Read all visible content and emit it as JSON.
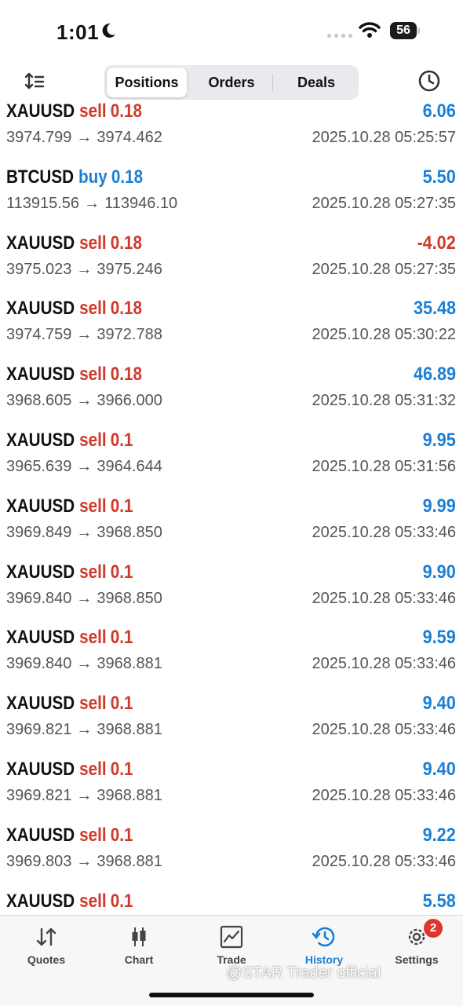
{
  "status_bar": {
    "time": "1:01",
    "battery": "56"
  },
  "toolbar": {
    "tabs": [
      {
        "label": "Positions",
        "active": true
      },
      {
        "label": "Orders",
        "active": false
      },
      {
        "label": "Deals",
        "active": false
      }
    ]
  },
  "deals": [
    {
      "symbol": "XAUUSD",
      "side": "sell",
      "volume": "0.18",
      "profit": "6.06",
      "open_price": "3974.799",
      "close_price": "3974.462",
      "time": "2025.10.28 05:25:57"
    },
    {
      "symbol": "BTCUSD",
      "side": "buy",
      "volume": "0.18",
      "profit": "5.50",
      "open_price": "113915.56",
      "close_price": "113946.10",
      "time": "2025.10.28 05:27:35"
    },
    {
      "symbol": "XAUUSD",
      "side": "sell",
      "volume": "0.18",
      "profit": "-4.02",
      "open_price": "3975.023",
      "close_price": "3975.246",
      "time": "2025.10.28 05:27:35"
    },
    {
      "symbol": "XAUUSD",
      "side": "sell",
      "volume": "0.18",
      "profit": "35.48",
      "open_price": "3974.759",
      "close_price": "3972.788",
      "time": "2025.10.28 05:30:22"
    },
    {
      "symbol": "XAUUSD",
      "side": "sell",
      "volume": "0.18",
      "profit": "46.89",
      "open_price": "3968.605",
      "close_price": "3966.000",
      "time": "2025.10.28 05:31:32"
    },
    {
      "symbol": "XAUUSD",
      "side": "sell",
      "volume": "0.1",
      "profit": "9.95",
      "open_price": "3965.639",
      "close_price": "3964.644",
      "time": "2025.10.28 05:31:56"
    },
    {
      "symbol": "XAUUSD",
      "side": "sell",
      "volume": "0.1",
      "profit": "9.99",
      "open_price": "3969.849",
      "close_price": "3968.850",
      "time": "2025.10.28 05:33:46"
    },
    {
      "symbol": "XAUUSD",
      "side": "sell",
      "volume": "0.1",
      "profit": "9.90",
      "open_price": "3969.840",
      "close_price": "3968.850",
      "time": "2025.10.28 05:33:46"
    },
    {
      "symbol": "XAUUSD",
      "side": "sell",
      "volume": "0.1",
      "profit": "9.59",
      "open_price": "3969.840",
      "close_price": "3968.881",
      "time": "2025.10.28 05:33:46"
    },
    {
      "symbol": "XAUUSD",
      "side": "sell",
      "volume": "0.1",
      "profit": "9.40",
      "open_price": "3969.821",
      "close_price": "3968.881",
      "time": "2025.10.28 05:33:46"
    },
    {
      "symbol": "XAUUSD",
      "side": "sell",
      "volume": "0.1",
      "profit": "9.40",
      "open_price": "3969.821",
      "close_price": "3968.881",
      "time": "2025.10.28 05:33:46"
    },
    {
      "symbol": "XAUUSD",
      "side": "sell",
      "volume": "0.1",
      "profit": "9.22",
      "open_price": "3969.803",
      "close_price": "3968.881",
      "time": "2025.10.28 05:33:46"
    },
    {
      "symbol": "XAUUSD",
      "side": "sell",
      "volume": "0.1",
      "profit": "5.58",
      "open_price": "",
      "close_price": "",
      "time": ""
    }
  ],
  "price_arrow": "→",
  "tabbar": {
    "tabs": [
      {
        "label": "Quotes",
        "icon": "quotes-arrows-icon"
      },
      {
        "label": "Chart",
        "icon": "candlestick-icon"
      },
      {
        "label": "Trade",
        "icon": "trade-chart-icon"
      },
      {
        "label": "History",
        "icon": "history-clock-icon",
        "active": true
      },
      {
        "label": "Settings",
        "icon": "gear-icon",
        "badge": "2"
      }
    ]
  },
  "watermark": "@STAR Trader official",
  "colors": {
    "sell": "#d0382b",
    "buy": "#1a7fd6",
    "profit_positive": "#1a7fd6",
    "profit_negative": "#d0382b",
    "active_tab": "#1a7fd6",
    "badge": "#e0352b"
  }
}
